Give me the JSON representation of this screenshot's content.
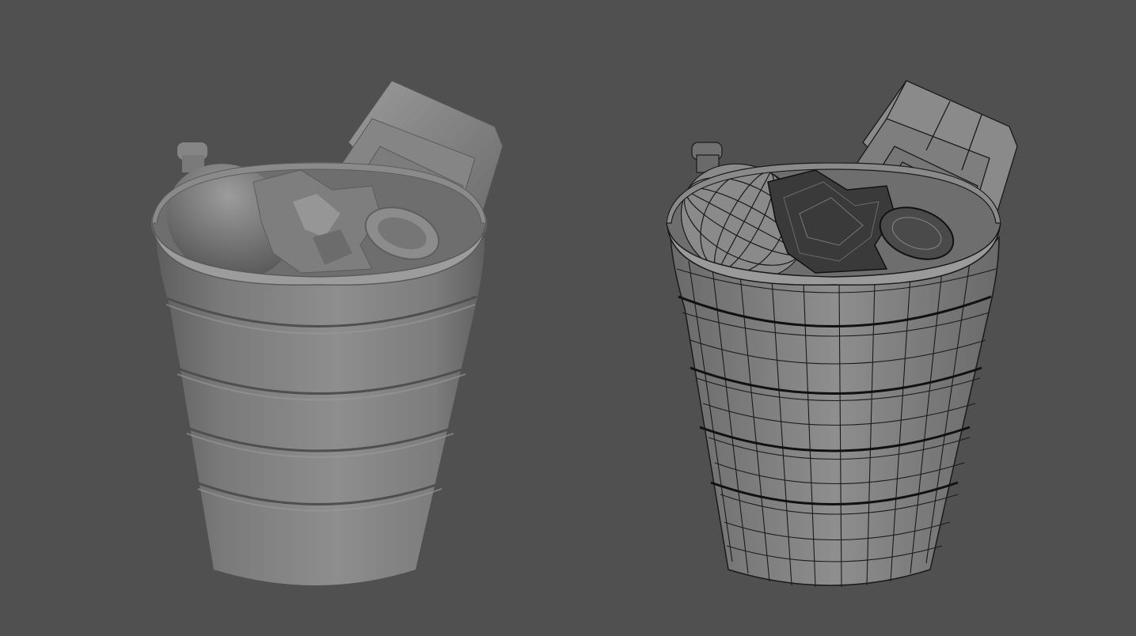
{
  "scene": {
    "background_color": "#505050",
    "models": [
      {
        "name": "trash-bin",
        "shading": "smooth-shaded",
        "body_color": "#8a8a8a"
      },
      {
        "name": "trash-bin",
        "shading": "wireframe-on-shaded",
        "body_color": "#8a8a8a",
        "wire_color": "#1a1a1a"
      }
    ]
  }
}
